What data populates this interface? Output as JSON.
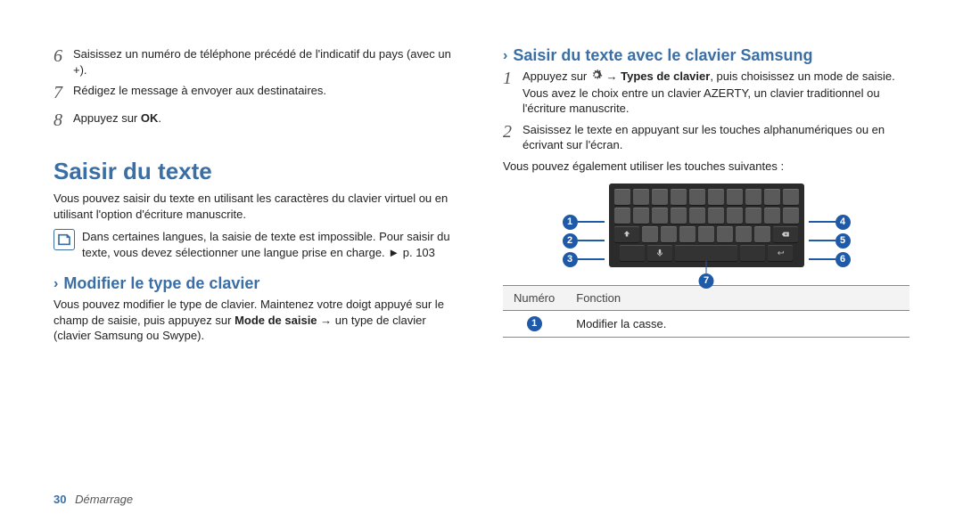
{
  "left": {
    "steps": [
      {
        "num": "6",
        "text": "Saisissez un numéro de téléphone précédé de l'indicatif du pays (avec un +)."
      },
      {
        "num": "7",
        "text": "Rédigez le message à envoyer aux destinataires."
      },
      {
        "num": "8",
        "pre": "Appuyez sur ",
        "bold": "OK",
        "post": "."
      }
    ],
    "section_title": "Saisir du texte",
    "intro": "Vous pouvez saisir du texte en utilisant les caractères du clavier virtuel ou en utilisant l'option d'écriture manuscrite.",
    "note": "Dans certaines langues, la saisie de texte est impossible. Pour saisir du texte, vous devez sélectionner une langue prise en charge. ► p. 103",
    "sub1_title": "Modifier le type de clavier",
    "sub1_text_pre": "Vous pouvez modifier le type de clavier. Maintenez votre doigt appuyé sur le champ de saisie, puis appuyez sur ",
    "sub1_text_bold": "Mode de saisie",
    "sub1_text_post": " → un type de clavier (clavier Samsung ou Swype)."
  },
  "right": {
    "sub2_title": "Saisir du texte avec le clavier Samsung",
    "step1": {
      "num": "1",
      "pre": "Appuyez sur ",
      "mid": " → ",
      "bold": "Types de clavier",
      "post": ", puis choisissez un mode de saisie."
    },
    "step1_note": "Vous avez le choix entre un clavier AZERTY, un clavier traditionnel ou l'écriture manuscrite.",
    "step2": {
      "num": "2",
      "text": "Saisissez le texte en appuyant sur les touches alphanumériques ou en écrivant sur l'écran."
    },
    "follow_text": "Vous pouvez également utiliser les touches suivantes :",
    "callouts_left": [
      "1",
      "2",
      "3"
    ],
    "callouts_right": [
      "4",
      "5",
      "6"
    ],
    "callout_bottom": "7",
    "table": {
      "h1": "Numéro",
      "h2": "Fonction",
      "row1_num": "1",
      "row1_text": "Modifier la casse."
    }
  },
  "footer": {
    "page": "30",
    "section": "Démarrage"
  }
}
